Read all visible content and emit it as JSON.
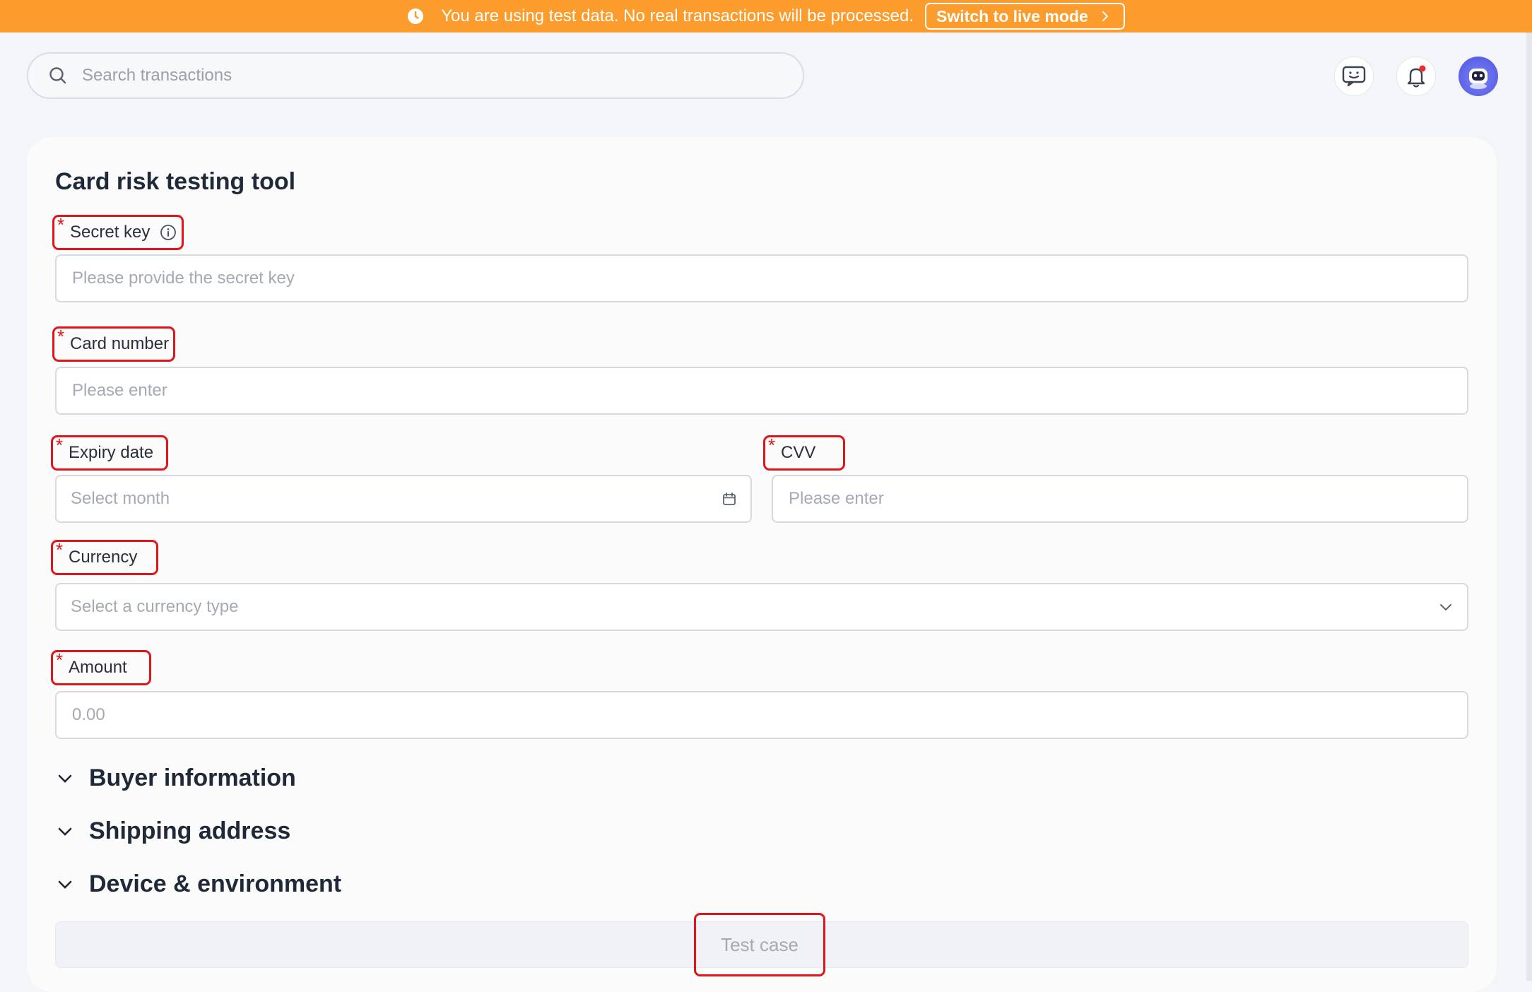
{
  "banner": {
    "message": "You are using test data. No real transactions will be processed.",
    "switch_label": "Switch to live mode",
    "color": "#fb9c2c"
  },
  "search": {
    "placeholder": "Search transactions",
    "value": ""
  },
  "topbar": {
    "icons": [
      "feedback-icon",
      "bell-icon",
      "avatar"
    ],
    "has_unread_notifications": true
  },
  "page": {
    "title": "Card risk testing tool"
  },
  "form": {
    "secret_key": {
      "label": "Secret key",
      "required_mark": "*",
      "placeholder": "Please provide the secret key",
      "value": ""
    },
    "card_number": {
      "label": "Card number",
      "required_mark": "*",
      "placeholder": "Please enter",
      "value": ""
    },
    "expiry_date": {
      "label": "Expiry date",
      "required_mark": "*",
      "placeholder": "Select month"
    },
    "cvv": {
      "label": "CVV",
      "required_mark": "*",
      "placeholder": "Please enter",
      "value": ""
    },
    "currency": {
      "label": "Currency",
      "required_mark": "*",
      "placeholder": "Select a currency type"
    },
    "amount": {
      "label": "Amount",
      "required_mark": "*",
      "placeholder": "0.00",
      "value": ""
    }
  },
  "sections": [
    {
      "label": "Buyer information"
    },
    {
      "label": "Shipping address"
    },
    {
      "label": "Device & environment"
    }
  ],
  "submit": {
    "label": "Test case"
  },
  "highlight_color": "#e0141a"
}
